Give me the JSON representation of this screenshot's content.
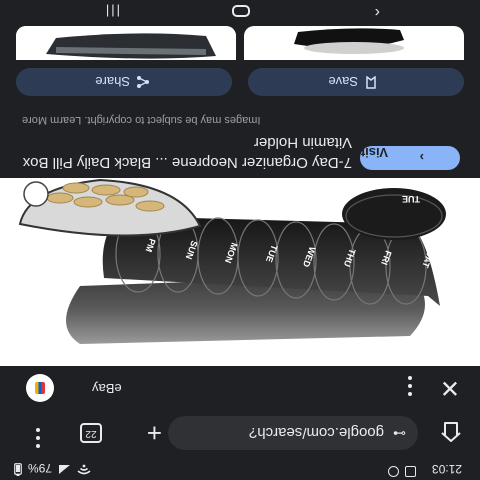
{
  "status_bar": {
    "time": "21:03",
    "battery": "79%"
  },
  "url_bar": {
    "url": "google.com/search?",
    "tab_count": "22"
  },
  "source": {
    "name": "eBay"
  },
  "result": {
    "title": "7-Day Organizer Neoprene ... Black Daily Pill Box Vitamin Holder",
    "copyright_notice": "Images may be subject to copyright. Learm More",
    "visit_label": "Visit",
    "save_label": "Save",
    "share_label": "Share"
  },
  "pillbox": {
    "day_labels": [
      "PM",
      "SUN",
      "MON",
      "TUE",
      "WED",
      "THU",
      "FRI",
      "SAT"
    ],
    "lid_label": "TUE"
  },
  "colors": {
    "background": "#1f2023",
    "accent": "#8ab4f8",
    "button_bg": "#2e3b55"
  }
}
